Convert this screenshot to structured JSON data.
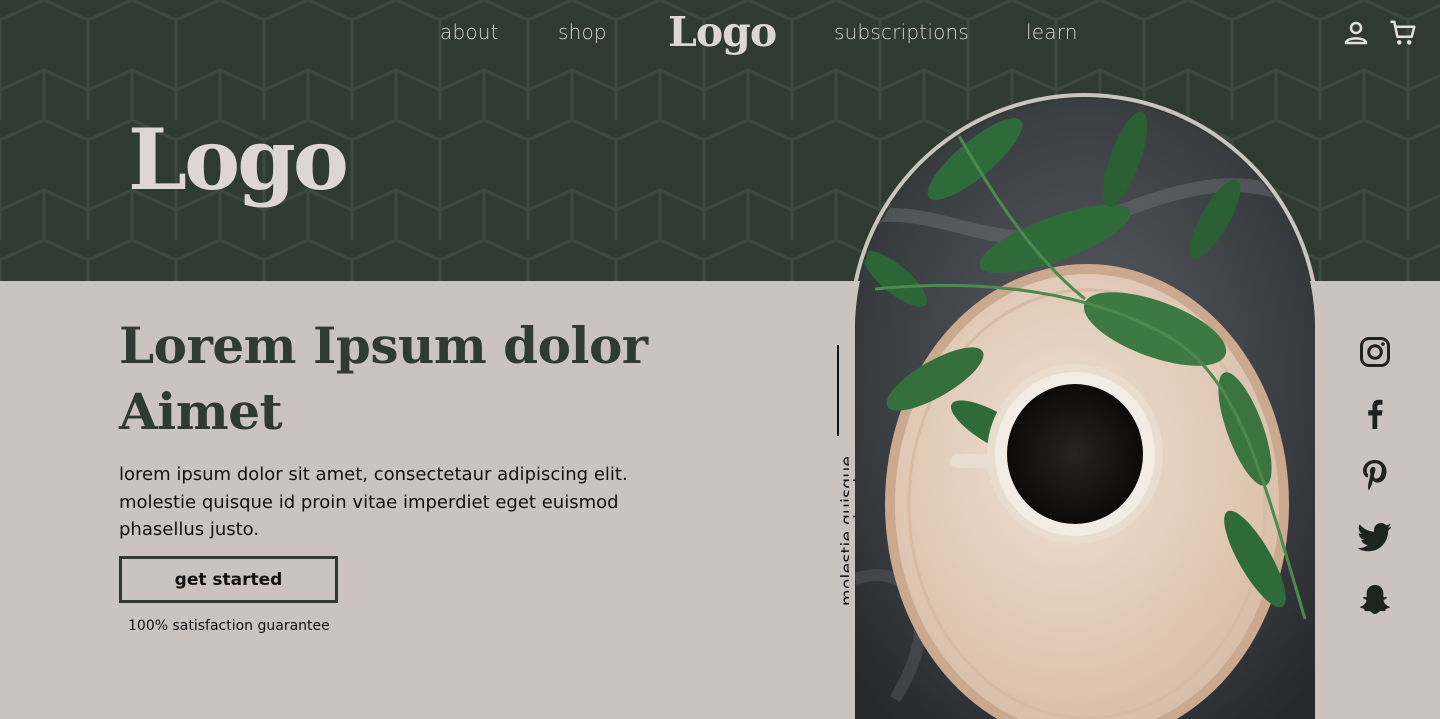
{
  "nav": {
    "links": [
      "about",
      "shop",
      "subscriptions",
      "learn"
    ],
    "logo": "Logo",
    "icons": [
      "account-icon",
      "cart-icon"
    ]
  },
  "hero": {
    "logo": "Logo",
    "headline_line1": "Lorem Ipsum dolor",
    "headline_line2": "Aimet",
    "body_line1": "lorem ipsum dolor sit amet, consectetaur adipiscing elit.",
    "body_line2": "molestie quisque id proin vitae imperdiet eget euismod",
    "body_line3": "phasellus justo.",
    "cta_label": "get started",
    "guarantee": "100% satisfaction guarantee",
    "vertical_caption": "molestie quisque"
  },
  "social": [
    "instagram-icon",
    "facebook-icon",
    "pinterest-icon",
    "twitter-icon",
    "snapchat-icon"
  ],
  "colors": {
    "dark_green": "#2f3b31",
    "taupe": "#cbc3be",
    "logo_light": "#ddd6d2"
  }
}
